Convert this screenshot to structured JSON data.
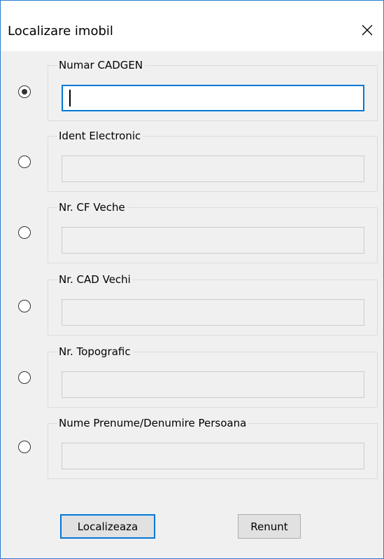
{
  "window": {
    "title": "Localizare imobil",
    "close_icon": "close-icon"
  },
  "search_options": [
    {
      "label": "Numar CADGEN",
      "value": "",
      "selected": true
    },
    {
      "label": "Ident Electronic",
      "value": "",
      "selected": false
    },
    {
      "label": "Nr. CF Veche",
      "value": "",
      "selected": false
    },
    {
      "label": "Nr. CAD Vechi",
      "value": "",
      "selected": false
    },
    {
      "label": "Nr. Topografic",
      "value": "",
      "selected": false
    },
    {
      "label": "Nume Prenume/Denumire Persoana",
      "value": "",
      "selected": false
    }
  ],
  "buttons": {
    "locate_label": "Localizeaza",
    "cancel_label": "Renunt"
  },
  "colors": {
    "accent": "#0078d7",
    "window_border": "#2b7bd1",
    "dialog_background": "#f0f0f0"
  }
}
